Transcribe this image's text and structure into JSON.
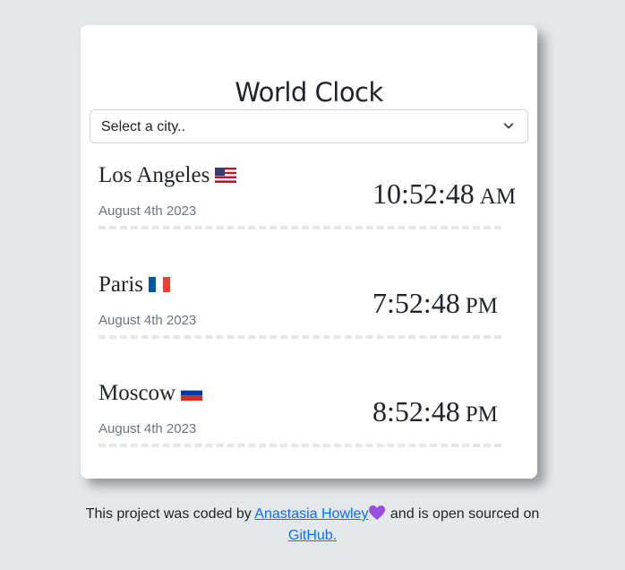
{
  "app": {
    "title": "World Clock"
  },
  "select": {
    "placeholder": "Select a city.."
  },
  "cities": [
    {
      "name": "Los Angeles",
      "flag": "us-flag-icon",
      "date": "August 4th 2023",
      "time": "10:52:48",
      "period": "AM"
    },
    {
      "name": "Paris",
      "flag": "fr-flag-icon",
      "date": "August 4th 2023",
      "time": "7:52:48",
      "period": "PM"
    },
    {
      "name": "Moscow",
      "flag": "ru-flag-icon",
      "date": "August 4th 2023",
      "time": "8:52:48",
      "period": "PM"
    }
  ],
  "footer": {
    "text_before": "This project was coded by",
    "author_link": "Anastasia Howley",
    "heart_icon": "purple-heart-icon",
    "text_middle": "and is open sourced on",
    "github_link": "GitHub."
  },
  "colors": {
    "background": "#e4e8eb",
    "card": "#ffffff",
    "link": "#0d6efd",
    "muted_text": "#6c757d",
    "divider": "#e6e6e6",
    "heart": "#9b4de0"
  }
}
